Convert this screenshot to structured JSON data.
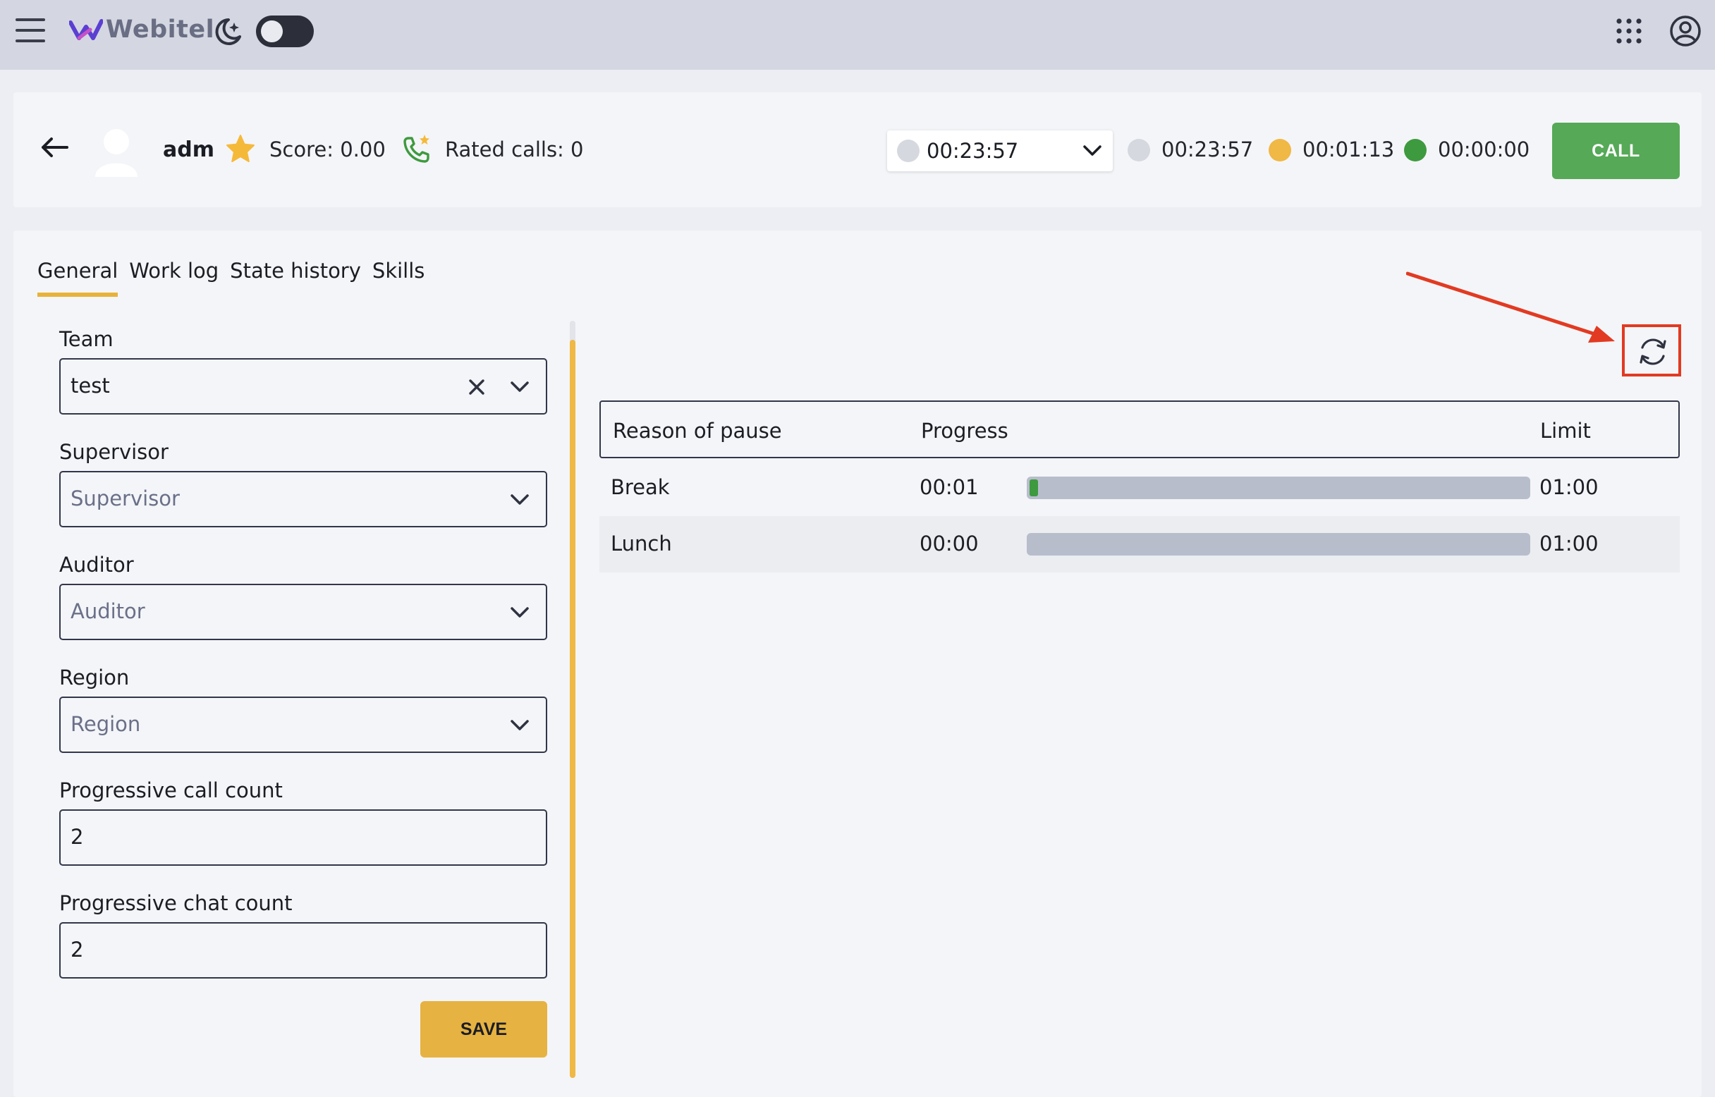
{
  "app": {
    "brand": "Webitel",
    "theme_toggle_state": "off"
  },
  "agent": {
    "name": "adm",
    "score": "Score: 0.00",
    "rated_calls": "Rated calls: 0",
    "status_select_value": "00:23:57",
    "timers": [
      {
        "value": "00:23:57",
        "color": "#d6d8e0"
      },
      {
        "value": "00:01:13",
        "color": "#f0b844"
      },
      {
        "value": "00:00:00",
        "color": "#3e9a3e"
      }
    ],
    "call_button": "CALL"
  },
  "tabs": [
    {
      "label": "General",
      "active": true
    },
    {
      "label": "Work log",
      "active": false
    },
    {
      "label": "State history",
      "active": false
    },
    {
      "label": "Skills",
      "active": false
    }
  ],
  "form": {
    "team": {
      "label": "Team",
      "value": "test"
    },
    "supervisor": {
      "label": "Supervisor",
      "placeholder": "Supervisor"
    },
    "auditor": {
      "label": "Auditor",
      "placeholder": "Auditor"
    },
    "region": {
      "label": "Region",
      "placeholder": "Region"
    },
    "progressive_call_count": {
      "label": "Progressive call count",
      "value": "2"
    },
    "progressive_chat_count": {
      "label": "Progressive chat count",
      "value": "2"
    },
    "save_button": "SAVE"
  },
  "pause_table": {
    "headers": {
      "reason": "Reason of pause",
      "progress": "Progress",
      "limit": "Limit"
    },
    "rows": [
      {
        "reason": "Break",
        "elapsed": "00:01",
        "limit": "01:00",
        "progress_fraction": 0.017
      },
      {
        "reason": "Lunch",
        "elapsed": "00:00",
        "limit": "01:00",
        "progress_fraction": 0
      }
    ]
  },
  "colors": {
    "accent": "#e8b23a",
    "call_green": "#56a957",
    "annotation_red": "#e23a22"
  }
}
